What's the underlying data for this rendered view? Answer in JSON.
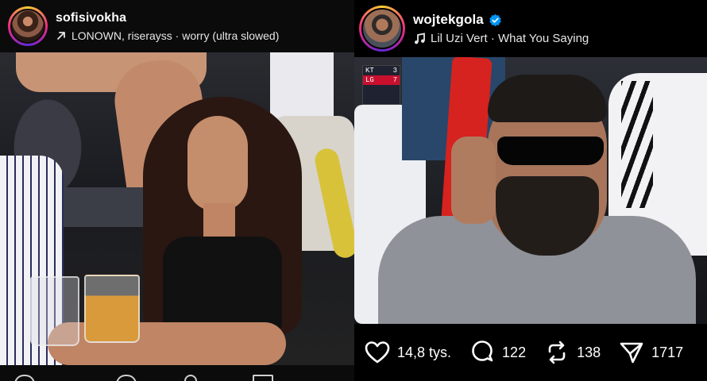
{
  "left_post": {
    "username": "sofisivokha",
    "audio_text": "LONOWN, riserayss · worry (ultra slowed)"
  },
  "right_post": {
    "username": "wojtekgola",
    "audio_text": "Lil Uzi Vert · What You Saying",
    "scoreboard": {
      "team1": "KT",
      "score1": "3",
      "team2": "LG",
      "score2": "7"
    },
    "actions": {
      "likes": "14,8 tys.",
      "comments": "122",
      "reposts": "138",
      "shares": "1717"
    }
  },
  "colors": {
    "verified": "#0095f6",
    "bat": "#d6231f"
  }
}
